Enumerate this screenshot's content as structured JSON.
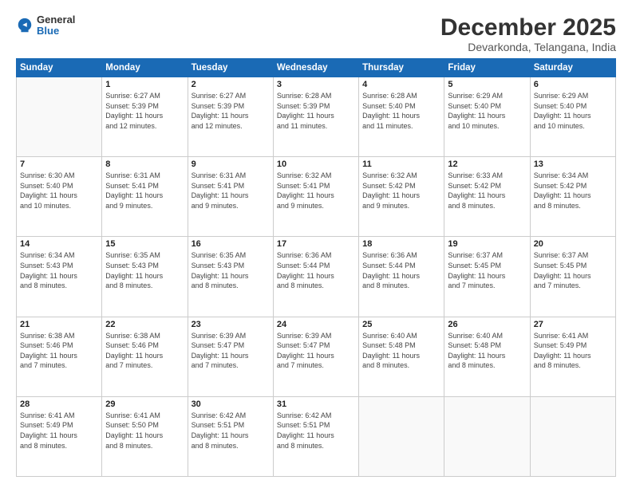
{
  "logo": {
    "general": "General",
    "blue": "Blue"
  },
  "title": "December 2025",
  "subtitle": "Devarkonda, Telangana, India",
  "days_of_week": [
    "Sunday",
    "Monday",
    "Tuesday",
    "Wednesday",
    "Thursday",
    "Friday",
    "Saturday"
  ],
  "weeks": [
    [
      {
        "day": "",
        "info": ""
      },
      {
        "day": "1",
        "info": "Sunrise: 6:27 AM\nSunset: 5:39 PM\nDaylight: 11 hours\nand 12 minutes."
      },
      {
        "day": "2",
        "info": "Sunrise: 6:27 AM\nSunset: 5:39 PM\nDaylight: 11 hours\nand 12 minutes."
      },
      {
        "day": "3",
        "info": "Sunrise: 6:28 AM\nSunset: 5:39 PM\nDaylight: 11 hours\nand 11 minutes."
      },
      {
        "day": "4",
        "info": "Sunrise: 6:28 AM\nSunset: 5:40 PM\nDaylight: 11 hours\nand 11 minutes."
      },
      {
        "day": "5",
        "info": "Sunrise: 6:29 AM\nSunset: 5:40 PM\nDaylight: 11 hours\nand 10 minutes."
      },
      {
        "day": "6",
        "info": "Sunrise: 6:29 AM\nSunset: 5:40 PM\nDaylight: 11 hours\nand 10 minutes."
      }
    ],
    [
      {
        "day": "7",
        "info": "Sunrise: 6:30 AM\nSunset: 5:40 PM\nDaylight: 11 hours\nand 10 minutes."
      },
      {
        "day": "8",
        "info": "Sunrise: 6:31 AM\nSunset: 5:41 PM\nDaylight: 11 hours\nand 9 minutes."
      },
      {
        "day": "9",
        "info": "Sunrise: 6:31 AM\nSunset: 5:41 PM\nDaylight: 11 hours\nand 9 minutes."
      },
      {
        "day": "10",
        "info": "Sunrise: 6:32 AM\nSunset: 5:41 PM\nDaylight: 11 hours\nand 9 minutes."
      },
      {
        "day": "11",
        "info": "Sunrise: 6:32 AM\nSunset: 5:42 PM\nDaylight: 11 hours\nand 9 minutes."
      },
      {
        "day": "12",
        "info": "Sunrise: 6:33 AM\nSunset: 5:42 PM\nDaylight: 11 hours\nand 8 minutes."
      },
      {
        "day": "13",
        "info": "Sunrise: 6:34 AM\nSunset: 5:42 PM\nDaylight: 11 hours\nand 8 minutes."
      }
    ],
    [
      {
        "day": "14",
        "info": "Sunrise: 6:34 AM\nSunset: 5:43 PM\nDaylight: 11 hours\nand 8 minutes."
      },
      {
        "day": "15",
        "info": "Sunrise: 6:35 AM\nSunset: 5:43 PM\nDaylight: 11 hours\nand 8 minutes."
      },
      {
        "day": "16",
        "info": "Sunrise: 6:35 AM\nSunset: 5:43 PM\nDaylight: 11 hours\nand 8 minutes."
      },
      {
        "day": "17",
        "info": "Sunrise: 6:36 AM\nSunset: 5:44 PM\nDaylight: 11 hours\nand 8 minutes."
      },
      {
        "day": "18",
        "info": "Sunrise: 6:36 AM\nSunset: 5:44 PM\nDaylight: 11 hours\nand 8 minutes."
      },
      {
        "day": "19",
        "info": "Sunrise: 6:37 AM\nSunset: 5:45 PM\nDaylight: 11 hours\nand 7 minutes."
      },
      {
        "day": "20",
        "info": "Sunrise: 6:37 AM\nSunset: 5:45 PM\nDaylight: 11 hours\nand 7 minutes."
      }
    ],
    [
      {
        "day": "21",
        "info": "Sunrise: 6:38 AM\nSunset: 5:46 PM\nDaylight: 11 hours\nand 7 minutes."
      },
      {
        "day": "22",
        "info": "Sunrise: 6:38 AM\nSunset: 5:46 PM\nDaylight: 11 hours\nand 7 minutes."
      },
      {
        "day": "23",
        "info": "Sunrise: 6:39 AM\nSunset: 5:47 PM\nDaylight: 11 hours\nand 7 minutes."
      },
      {
        "day": "24",
        "info": "Sunrise: 6:39 AM\nSunset: 5:47 PM\nDaylight: 11 hours\nand 7 minutes."
      },
      {
        "day": "25",
        "info": "Sunrise: 6:40 AM\nSunset: 5:48 PM\nDaylight: 11 hours\nand 8 minutes."
      },
      {
        "day": "26",
        "info": "Sunrise: 6:40 AM\nSunset: 5:48 PM\nDaylight: 11 hours\nand 8 minutes."
      },
      {
        "day": "27",
        "info": "Sunrise: 6:41 AM\nSunset: 5:49 PM\nDaylight: 11 hours\nand 8 minutes."
      }
    ],
    [
      {
        "day": "28",
        "info": "Sunrise: 6:41 AM\nSunset: 5:49 PM\nDaylight: 11 hours\nand 8 minutes."
      },
      {
        "day": "29",
        "info": "Sunrise: 6:41 AM\nSunset: 5:50 PM\nDaylight: 11 hours\nand 8 minutes."
      },
      {
        "day": "30",
        "info": "Sunrise: 6:42 AM\nSunset: 5:51 PM\nDaylight: 11 hours\nand 8 minutes."
      },
      {
        "day": "31",
        "info": "Sunrise: 6:42 AM\nSunset: 5:51 PM\nDaylight: 11 hours\nand 8 minutes."
      },
      {
        "day": "",
        "info": ""
      },
      {
        "day": "",
        "info": ""
      },
      {
        "day": "",
        "info": ""
      }
    ]
  ]
}
